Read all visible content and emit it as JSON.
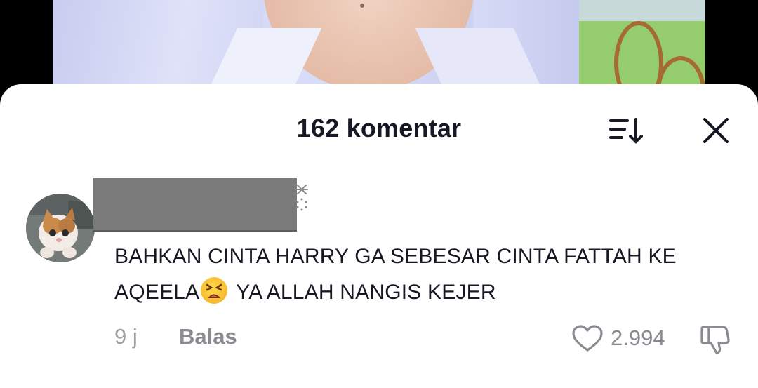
{
  "header": {
    "title": "162 komentar",
    "sort_icon": "sort-descending-icon",
    "close_icon": "close-icon"
  },
  "comment": {
    "avatar_icon": "kitten-avatar",
    "username_redacted": true,
    "text_line1": "BAHKAN CINTA HARRY GA SEBESAR CINTA FATTAH KE",
    "text_line2_before": "AQEELA",
    "emoji": "tired-face-emoji",
    "text_line2_after": " YA ALLAH NANGIS KEJER",
    "time": "9 j",
    "reply_label": "Balas",
    "like_count": "2.994",
    "like_icon": "heart-outline-icon",
    "dislike_icon": "thumbs-down-icon"
  },
  "colors": {
    "text_primary": "#161823",
    "text_secondary": "#8a8b91",
    "sheet_bg": "#ffffff"
  }
}
